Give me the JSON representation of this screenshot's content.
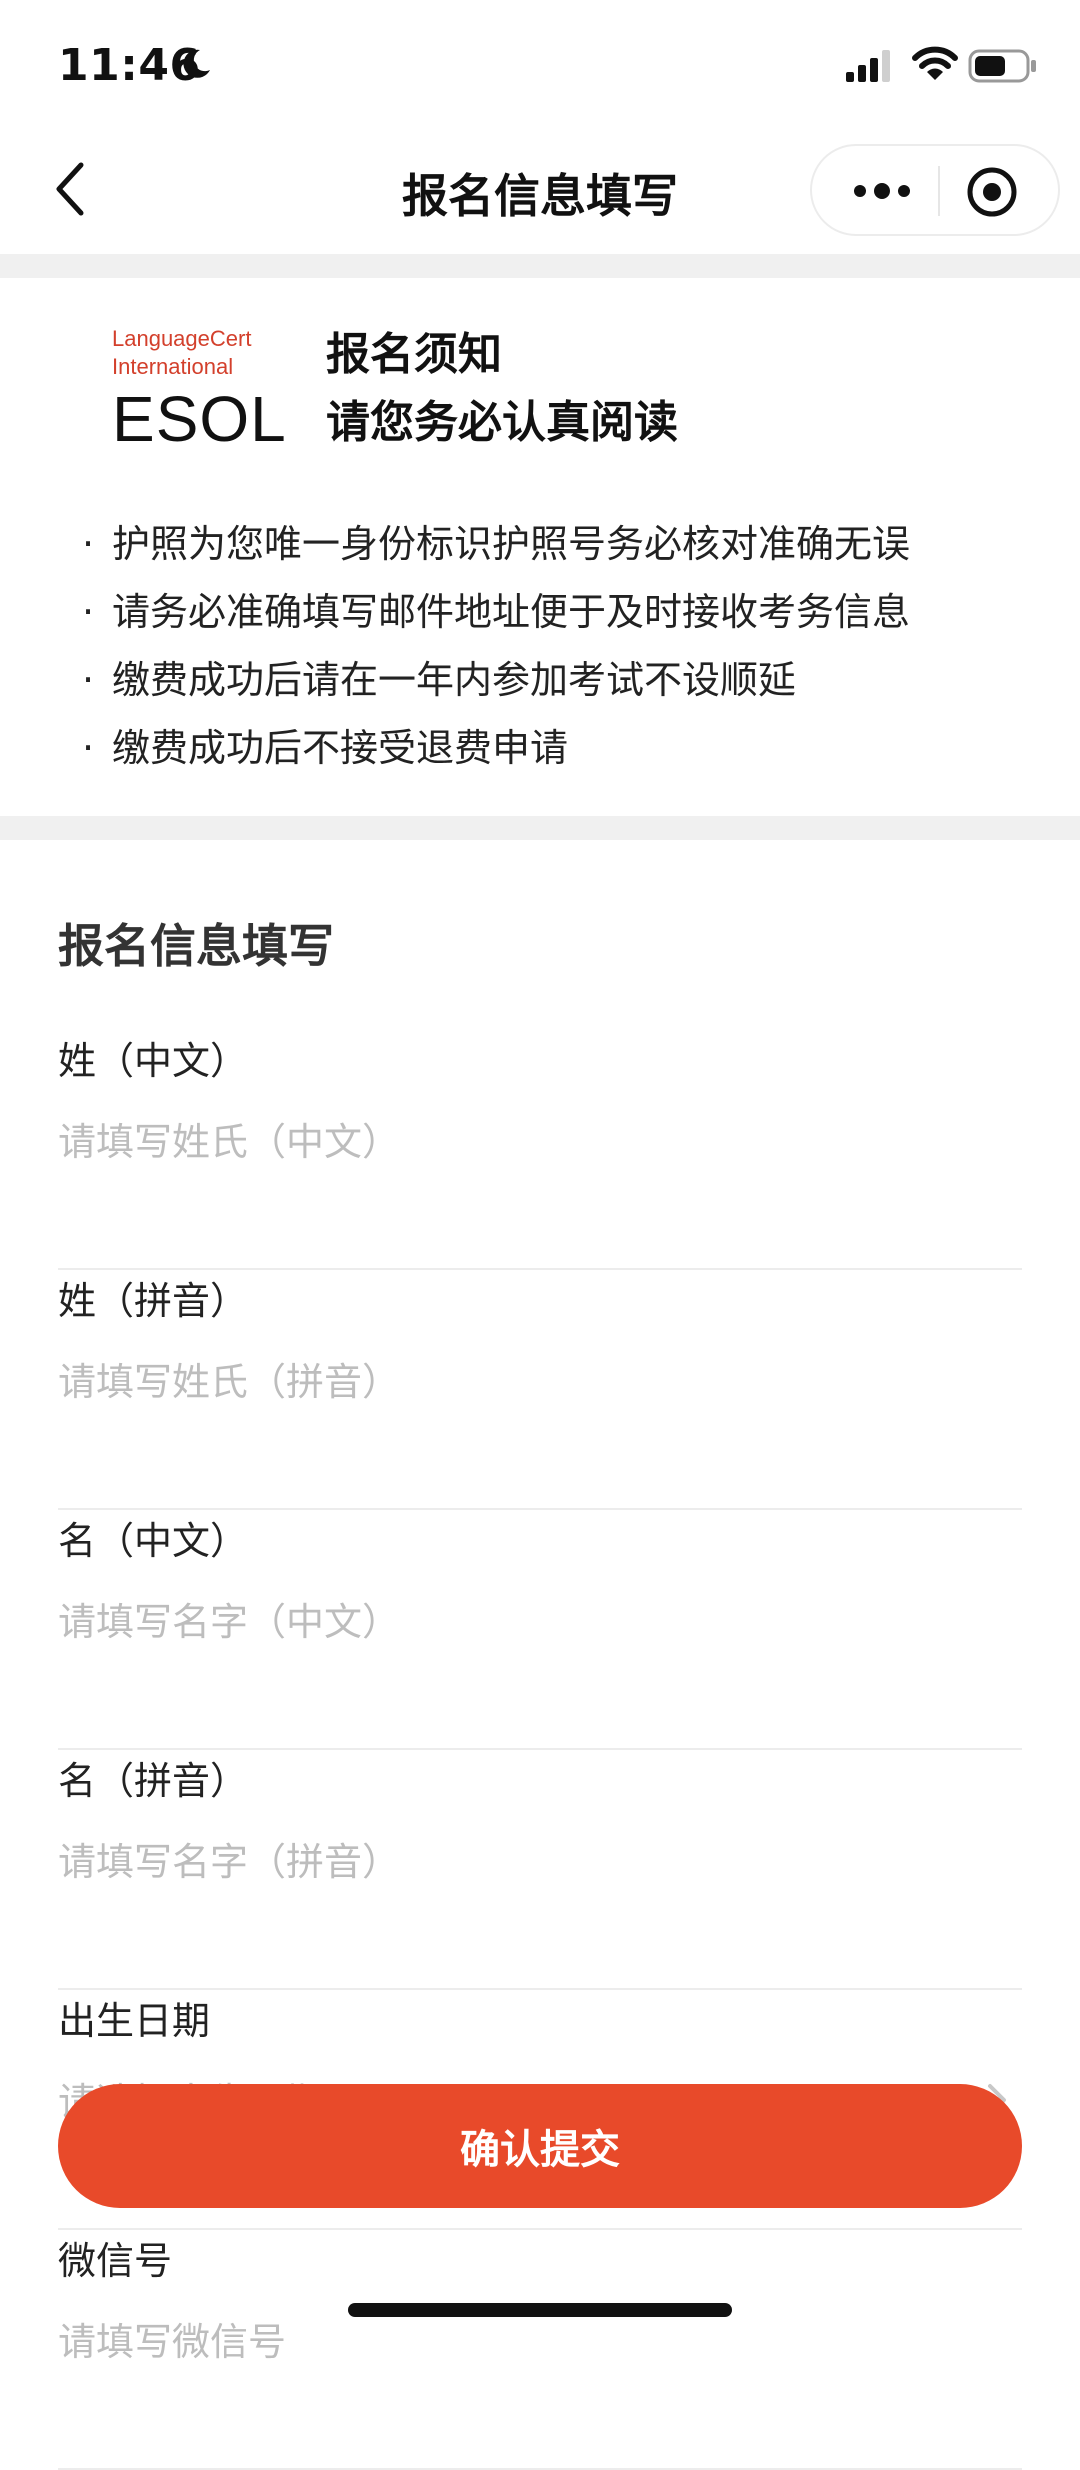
{
  "status_bar": {
    "time": "11:46"
  },
  "nav": {
    "title": "报名信息填写"
  },
  "notice": {
    "logo": {
      "line1": "LanguageCert",
      "line2": "International",
      "line3": "ESOL"
    },
    "title": "报名须知",
    "subtitle": "请您务必认真阅读",
    "rules": [
      "护照为您唯一身份标识护照号务必核对准确无误",
      "请务必准确填写邮件地址便于及时接收考务信息",
      "缴费成功后请在一年内参加考试不设顺延",
      "缴费成功后不接受退费申请"
    ],
    "bullet": "·"
  },
  "form": {
    "title": "报名信息填写",
    "fields": [
      {
        "label": "姓（中文）",
        "placeholder": "请填写姓氏（中文）"
      },
      {
        "label": "姓（拼音）",
        "placeholder": "请填写姓氏（拼音）"
      },
      {
        "label": "名（中文）",
        "placeholder": "请填写名字（中文）"
      },
      {
        "label": "名（拼音）",
        "placeholder": "请填写名字（拼音）"
      },
      {
        "label": "出生日期",
        "placeholder": "请选择出生日期"
      },
      {
        "label": "微信号",
        "placeholder": "请填写微信号"
      }
    ]
  },
  "submit": {
    "label": "确认提交"
  },
  "colors": {
    "accent": "#e84a2a",
    "logo_red": "#d3402c",
    "placeholder": "#bdbdbd",
    "band": "#f0f0f0"
  }
}
